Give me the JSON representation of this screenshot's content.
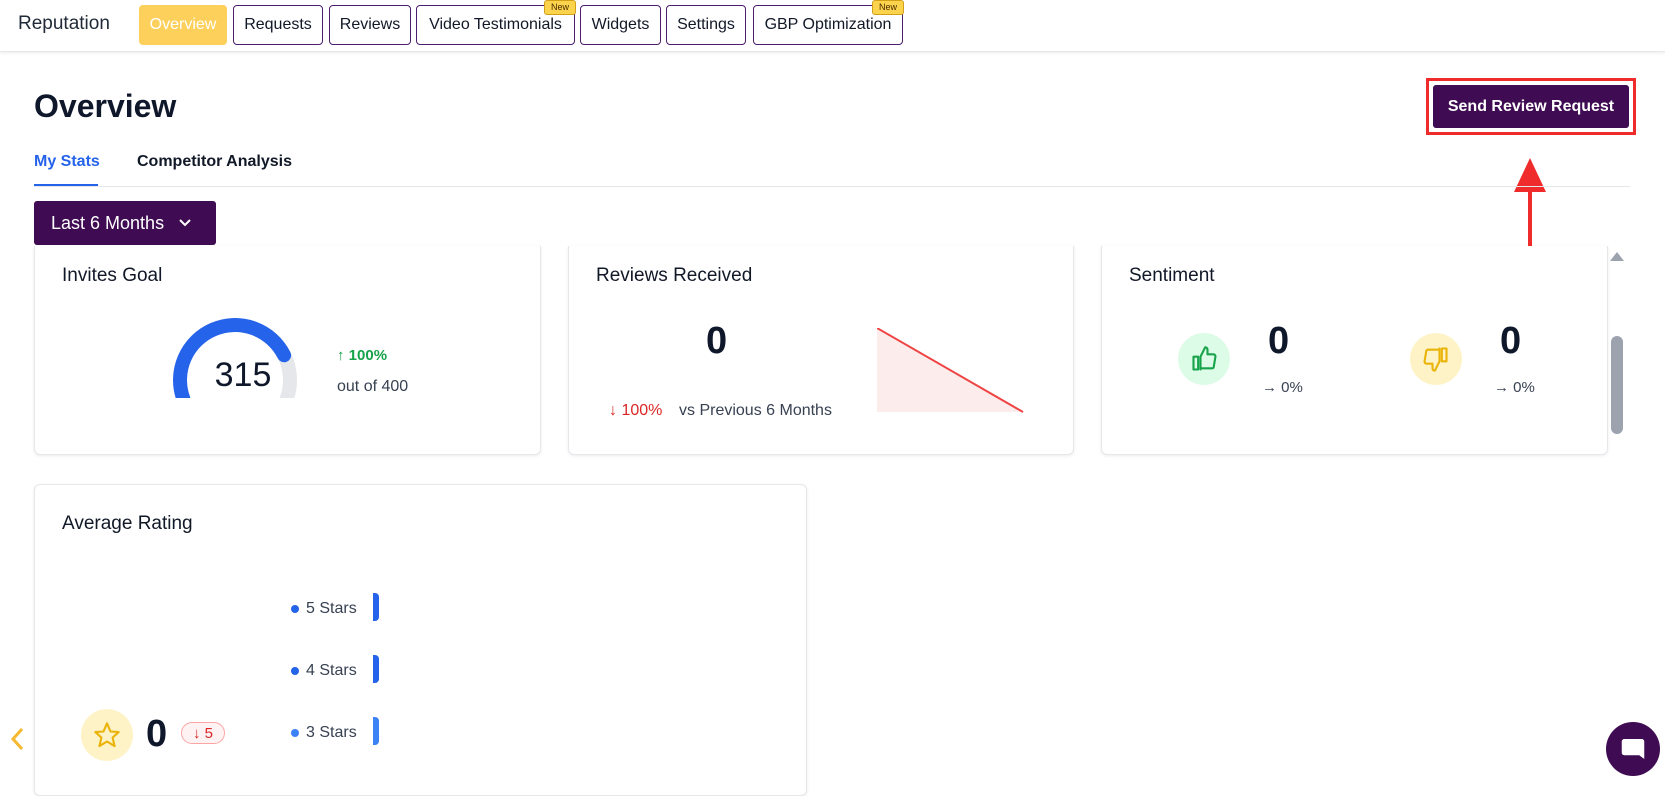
{
  "app": {
    "title": "Reputation"
  },
  "nav": {
    "tabs": [
      {
        "label": "Overview",
        "active": true,
        "new": false
      },
      {
        "label": "Requests",
        "active": false,
        "new": false
      },
      {
        "label": "Reviews",
        "active": false,
        "new": false
      },
      {
        "label": "Video Testimonials",
        "active": false,
        "new": true
      },
      {
        "label": "Widgets",
        "active": false,
        "new": false
      },
      {
        "label": "Settings",
        "active": false,
        "new": false
      },
      {
        "label": "GBP Optimization",
        "active": false,
        "new": true
      }
    ],
    "new_badge": "New"
  },
  "header": {
    "page_title": "Overview",
    "send_button": "Send Review Request"
  },
  "subtabs": {
    "my_stats": "My Stats",
    "competitor": "Competitor Analysis"
  },
  "range": {
    "label": "Last 6 Months"
  },
  "invites": {
    "title": "Invites Goal",
    "value": "315",
    "change": "100%",
    "out_of": "out of 400",
    "progress": 0.7875
  },
  "reviews": {
    "title": "Reviews Received",
    "value": "0",
    "change": "100%",
    "compare": "vs Previous 6 Months"
  },
  "sentiment": {
    "title": "Sentiment",
    "positive": {
      "value": "0",
      "pct": "0%"
    },
    "negative": {
      "value": "0",
      "pct": "0%"
    }
  },
  "avg_rating": {
    "title": "Average Rating",
    "value": "0",
    "change": "5",
    "rows": [
      "5 Stars",
      "4 Stars",
      "3 Stars"
    ]
  },
  "colors": {
    "brand": "#3f0b52",
    "accent": "#fcd05a",
    "link": "#2563eb",
    "positive": "#16a34a",
    "negative": "#dc2626",
    "highlight": "#ef2b2b"
  },
  "icons": [
    "thumbs-up-icon",
    "thumbs-down-icon",
    "star-icon",
    "chevron-down-icon",
    "chevron-left-icon",
    "chat-icon",
    "arrow-up-icon",
    "arrow-down-icon",
    "arrow-right-icon"
  ]
}
